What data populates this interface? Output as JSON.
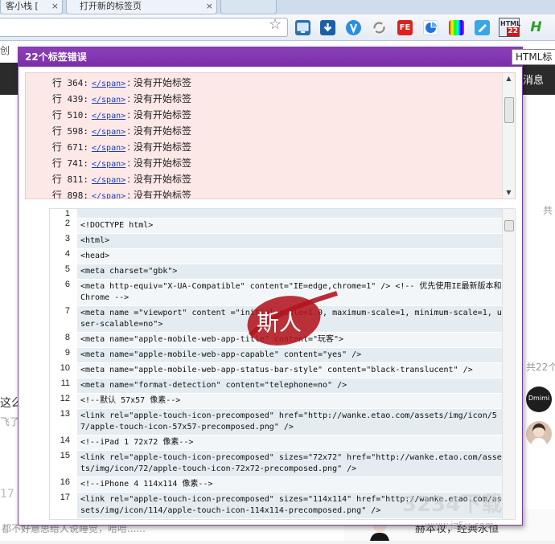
{
  "browser": {
    "tabs": [
      {
        "label": "客小栈 [ ",
        "close": "×"
      },
      {
        "label": "打开新的标签页",
        "close": "×"
      }
    ],
    "star": "☆",
    "extensions": [
      "monitor-icon",
      "download-icon",
      "vimium-icon",
      "sync-icon",
      "fe-icon",
      "stats-icon",
      "color-icon",
      "note-icon",
      "html-validator-icon",
      "h-icon"
    ],
    "ext_labels": {
      "fe": "FE",
      "html": "HTML",
      "html_badge": "22",
      "h": "H"
    }
  },
  "page": {
    "left_cut": "创",
    "nav_right": "消息",
    "tooltip": "HTML标",
    "side_gong1": "共",
    "side_gong2": "共22个",
    "left_zhe": "这么",
    "left_fei": "飞了",
    "left_seventeen": "17",
    "bottom_left": "都不好意思给人说睡觉，哈哈......",
    "bottom_right": "赫本妆，经典永恒",
    "dmimi": "Dmimi",
    "site_wm": "3234下载",
    "site_url": "www.jz5u.com"
  },
  "popup": {
    "title": "22个标签错误",
    "errors": [
      {
        "prefix": "行",
        "line": "364:",
        "tag": "</span>",
        "msg": ": 没有开始标签"
      },
      {
        "prefix": "行",
        "line": "439:",
        "tag": "</span>",
        "msg": ": 没有开始标签"
      },
      {
        "prefix": "行",
        "line": "510:",
        "tag": "</span>",
        "msg": ": 没有开始标签"
      },
      {
        "prefix": "行",
        "line": "598:",
        "tag": "</span>",
        "msg": ": 没有开始标签"
      },
      {
        "prefix": "行",
        "line": "671:",
        "tag": "</span>",
        "msg": ": 没有开始标签"
      },
      {
        "prefix": "行",
        "line": "741:",
        "tag": "</span>",
        "msg": ": 没有开始标签"
      },
      {
        "prefix": "行",
        "line": "811:",
        "tag": "</span>",
        "msg": ": 没有开始标签"
      },
      {
        "prefix": "行",
        "line": "898:",
        "tag": "</span>",
        "msg": ": 没有开始标签"
      }
    ],
    "code": [
      {
        "n": "1",
        "text": ""
      },
      {
        "n": "2",
        "text": "<!DOCTYPE html>"
      },
      {
        "n": "3",
        "text": "<html>"
      },
      {
        "n": "4",
        "text": "<head>"
      },
      {
        "n": "5",
        "text": "<meta charset=\"gbk\">"
      },
      {
        "n": "6",
        "text": "<meta http-equiv=\"X-UA-Compatible\" content=\"IE=edge,chrome=1\" /> <!-- 优先使用IE最新版本和 Chrome -->"
      },
      {
        "n": "7",
        "text": "<meta name =\"viewport\" content =\"initial-scale=1.0, maximum-scale=1, minimum-scale=1, user-scalable=no\">"
      },
      {
        "n": "8",
        "text": "<meta name=\"apple-mobile-web-app-title\" content=\"玩客\">"
      },
      {
        "n": "9",
        "text": "<meta name=\"apple-mobile-web-app-capable\" content=\"yes\" />"
      },
      {
        "n": "10",
        "text": "<meta name=\"apple-mobile-web-app-status-bar-style\" content=\"black-translucent\" />"
      },
      {
        "n": "11",
        "text": "<meta name=\"format-detection\" content=\"telephone=no\" />"
      },
      {
        "n": "12",
        "text": "<!--默认 57x57 像素-->"
      },
      {
        "n": "13",
        "text": "<link rel=\"apple-touch-icon-precomposed\" href=\"http://wanke.etao.com/assets/img/icon/57/apple-touch-icon-57x57-precomposed.png\" />"
      },
      {
        "n": "14",
        "text": "<!--iPad 1 72x72 像素-->"
      },
      {
        "n": "15",
        "text": "<link rel=\"apple-touch-icon-precomposed\" sizes=\"72x72\" href=\"http://wanke.etao.com/assets/img/icon/72/apple-touch-icon-72x72-precomposed.png\" />"
      },
      {
        "n": "16",
        "text": "<!--iPhone 4 114x114 像素-->"
      },
      {
        "n": "17",
        "text": "<link rel=\"apple-touch-icon-precomposed\" sizes=\"114x114\" href=\"http://wanke.etao.com/assets/img/icon/114/apple-touch-icon-114x114-precomposed.png\" />"
      }
    ],
    "watermark_text": "斯人"
  }
}
